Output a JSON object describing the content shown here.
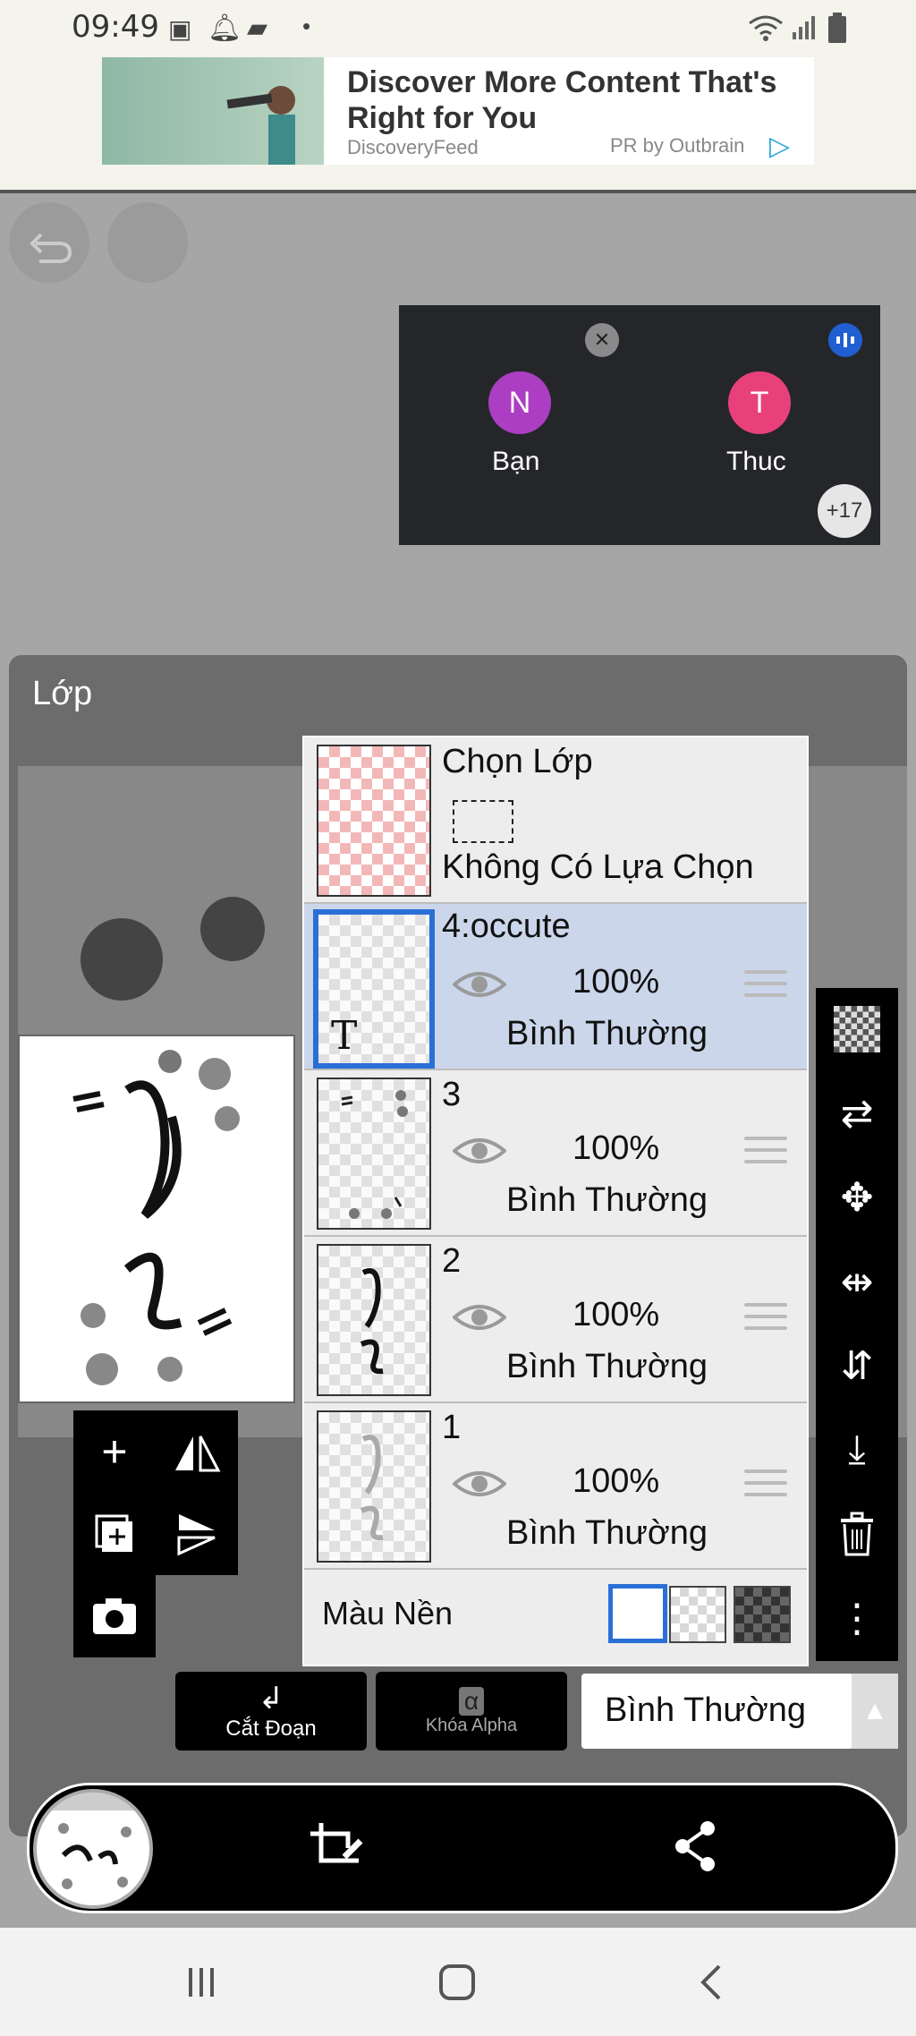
{
  "status": {
    "time": "09:49"
  },
  "ad": {
    "title": "Discover More Content That's Right for You",
    "source": "DiscoveryFeed",
    "provider": "PR by Outbrain"
  },
  "call": {
    "participants": [
      {
        "initial": "N",
        "name": "Bạn",
        "color": "#ab3ec3"
      },
      {
        "initial": "T",
        "name": "Thuc",
        "color": "#e8417a"
      }
    ],
    "more_count": "+17"
  },
  "layer_panel": {
    "title": "Lớp",
    "selection": {
      "title": "Chọn Lớp",
      "status": "Không Có Lựa Chọn"
    },
    "layers": [
      {
        "name": "4:occute",
        "opacity": "100%",
        "blend": "Bình Thường",
        "active": true
      },
      {
        "name": "3",
        "opacity": "100%",
        "blend": "Bình Thường",
        "active": false
      },
      {
        "name": "2",
        "opacity": "100%",
        "blend": "Bình Thường",
        "active": false
      },
      {
        "name": "1",
        "opacity": "100%",
        "blend": "Bình Thường",
        "active": false
      }
    ],
    "background_label": "Màu Nền",
    "clip_label": "Cắt Đoạn",
    "alpha_lock_label": "Khóa Alpha",
    "blend_mode": "Bình Thường"
  },
  "accent": "#2a6fd6"
}
